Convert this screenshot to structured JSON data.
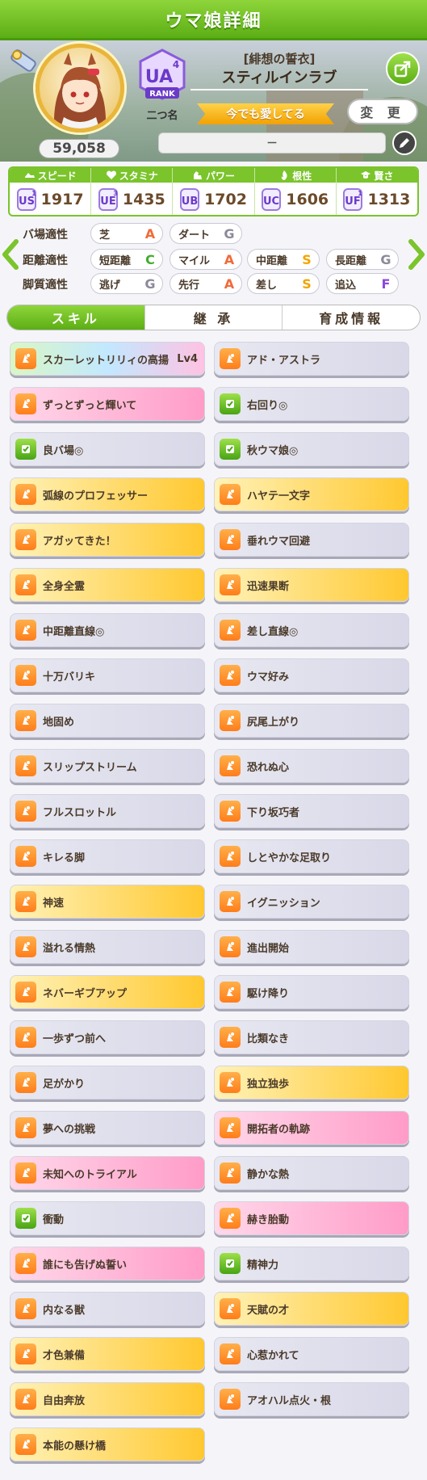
{
  "page_title": "ウマ娘詳細",
  "profile": {
    "score": "59,058",
    "rank": "UA",
    "rank_sub": "4",
    "rank_word": "RANK",
    "nickname": "二つ名",
    "outfit_title": "[緋想の誓衣]",
    "character_name": "スティルインラブ",
    "motto": "今でも愛してる",
    "change_label": "変 更",
    "subname": "－"
  },
  "stats": [
    {
      "label": "スピード",
      "grade": "US",
      "grade_sub": "1",
      "value": "1917",
      "icon": "shoe-icon"
    },
    {
      "label": "スタミナ",
      "grade": "UE",
      "grade_sub": "3",
      "value": "1435",
      "icon": "heart-icon"
    },
    {
      "label": "パワー",
      "grade": "UB",
      "grade_sub": "",
      "value": "1702",
      "icon": "muscle-icon"
    },
    {
      "label": "根性",
      "grade": "UC",
      "grade_sub": "",
      "value": "1606",
      "icon": "flame-icon"
    },
    {
      "label": "賢さ",
      "grade": "UF",
      "grade_sub": "1",
      "value": "1313",
      "icon": "graduation-icon"
    }
  ],
  "aptitude": {
    "rows": [
      {
        "label": "バ場適性",
        "cells": [
          {
            "name": "芝",
            "grade": "A"
          },
          {
            "name": "ダート",
            "grade": "G"
          }
        ]
      },
      {
        "label": "距離適性",
        "cells": [
          {
            "name": "短距離",
            "grade": "C"
          },
          {
            "name": "マイル",
            "grade": "A"
          },
          {
            "name": "中距離",
            "grade": "S"
          },
          {
            "name": "長距離",
            "grade": "G"
          }
        ]
      },
      {
        "label": "脚質適性",
        "cells": [
          {
            "name": "逃げ",
            "grade": "G"
          },
          {
            "name": "先行",
            "grade": "A"
          },
          {
            "name": "差し",
            "grade": "S"
          },
          {
            "name": "追込",
            "grade": "F"
          }
        ]
      }
    ],
    "grade_colors": {
      "S": "#f2a500",
      "A": "#f26a3a",
      "C": "#3fae2a",
      "F": "#8a4adc",
      "G": "#8a8a9a"
    }
  },
  "tabs": [
    "スキル",
    "継 承",
    "育成情報"
  ],
  "skills": [
    {
      "name": "スカーレットリリィの高揚",
      "level": "Lv4",
      "style": "rainbow",
      "icon": "orange"
    },
    {
      "name": "アド・アストラ",
      "style": "white",
      "icon": "orange"
    },
    {
      "name": "ずっとずっと輝いて",
      "style": "pink",
      "icon": "orange"
    },
    {
      "name": "右回り◎",
      "style": "white",
      "icon": "green"
    },
    {
      "name": "良バ場◎",
      "style": "white",
      "icon": "green"
    },
    {
      "name": "秋ウマ娘◎",
      "style": "white",
      "icon": "green"
    },
    {
      "name": "弧線のプロフェッサー",
      "style": "gold",
      "icon": "orange"
    },
    {
      "name": "ハヤテ一文字",
      "style": "gold",
      "icon": "orange"
    },
    {
      "name": "アガッてきた！",
      "style": "gold",
      "icon": "orange"
    },
    {
      "name": "垂れウマ回避",
      "style": "white",
      "icon": "orange"
    },
    {
      "name": "全身全霊",
      "style": "gold",
      "icon": "orange"
    },
    {
      "name": "迅速果断",
      "style": "gold",
      "icon": "orange"
    },
    {
      "name": "中距離直線◎",
      "style": "white",
      "icon": "orange"
    },
    {
      "name": "差し直線◎",
      "style": "white",
      "icon": "orange"
    },
    {
      "name": "十万バリキ",
      "style": "white",
      "icon": "orange"
    },
    {
      "name": "ウマ好み",
      "style": "white",
      "icon": "orange"
    },
    {
      "name": "地固め",
      "style": "white",
      "icon": "orange"
    },
    {
      "name": "尻尾上がり",
      "style": "white",
      "icon": "orange"
    },
    {
      "name": "スリップストリーム",
      "style": "white",
      "icon": "orange"
    },
    {
      "name": "恐れぬ心",
      "style": "white",
      "icon": "orange"
    },
    {
      "name": "フルスロットル",
      "style": "white",
      "icon": "orange"
    },
    {
      "name": "下り坂巧者",
      "style": "white",
      "icon": "orange"
    },
    {
      "name": "キレる脚",
      "style": "white",
      "icon": "orange"
    },
    {
      "name": "しとやかな足取り",
      "style": "white",
      "icon": "orange"
    },
    {
      "name": "神速",
      "style": "gold",
      "icon": "orange"
    },
    {
      "name": "イグニッション",
      "style": "white",
      "icon": "orange"
    },
    {
      "name": "溢れる情熱",
      "style": "white",
      "icon": "orange"
    },
    {
      "name": "進出開始",
      "style": "white",
      "icon": "orange"
    },
    {
      "name": "ネバーギブアップ",
      "style": "gold",
      "icon": "orange"
    },
    {
      "name": "駆け降り",
      "style": "white",
      "icon": "orange"
    },
    {
      "name": "一歩ずつ前へ",
      "style": "white",
      "icon": "orange"
    },
    {
      "name": "比類なき",
      "style": "white",
      "icon": "orange"
    },
    {
      "name": "足がかり",
      "style": "white",
      "icon": "orange"
    },
    {
      "name": "独立独歩",
      "style": "gold",
      "icon": "orange"
    },
    {
      "name": "夢への挑戦",
      "style": "white",
      "icon": "orange"
    },
    {
      "name": "開拓者の軌跡",
      "style": "pink",
      "icon": "orange"
    },
    {
      "name": "未知へのトライアル",
      "style": "pink",
      "icon": "orange"
    },
    {
      "name": "静かな熱",
      "style": "white",
      "icon": "orange"
    },
    {
      "name": "衝動",
      "style": "white",
      "icon": "green"
    },
    {
      "name": "赫き胎動",
      "style": "pink",
      "icon": "orange"
    },
    {
      "name": "誰にも告げぬ誓い",
      "style": "pink",
      "icon": "orange"
    },
    {
      "name": "精神力",
      "style": "white",
      "icon": "green"
    },
    {
      "name": "内なる獣",
      "style": "white",
      "icon": "orange"
    },
    {
      "name": "天賦の才",
      "style": "gold",
      "icon": "orange"
    },
    {
      "name": "才色兼備",
      "style": "gold",
      "icon": "orange"
    },
    {
      "name": "心惹かれて",
      "style": "white",
      "icon": "orange"
    },
    {
      "name": "自由奔放",
      "style": "gold",
      "icon": "orange"
    },
    {
      "name": "アオハル点火・根",
      "style": "white",
      "icon": "orange"
    },
    {
      "name": "本能の懸け橋",
      "style": "gold",
      "icon": "orange"
    }
  ]
}
